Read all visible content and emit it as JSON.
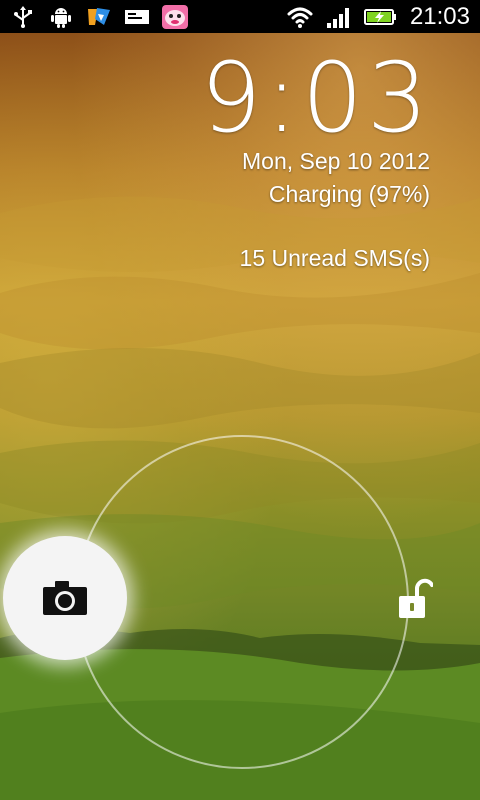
{
  "status_bar": {
    "time": "21:03",
    "left_icons": [
      "usb-icon",
      "android-debug-icon",
      "app-notification-icon",
      "sms-message-icon",
      "cartoon-app-icon"
    ],
    "right_icons": [
      "wifi-icon",
      "signal-strength-icon",
      "battery-charging-icon"
    ]
  },
  "lockscreen": {
    "clock": "9:03",
    "date": "Mon, Sep 10 2012",
    "charging": "Charging (97%)",
    "sms": "15 Unread SMS(s)",
    "battery_level_percent": 97
  },
  "targets": {
    "left": "camera-icon",
    "right": "unlock-icon"
  },
  "colors": {
    "sky_top": "#9a5a1a",
    "sky_mid": "#c8a033",
    "hills_mid": "#8f9a2a",
    "grass": "#4f7a1f",
    "status_bar": "#000000",
    "battery_green": "#7fd321"
  }
}
